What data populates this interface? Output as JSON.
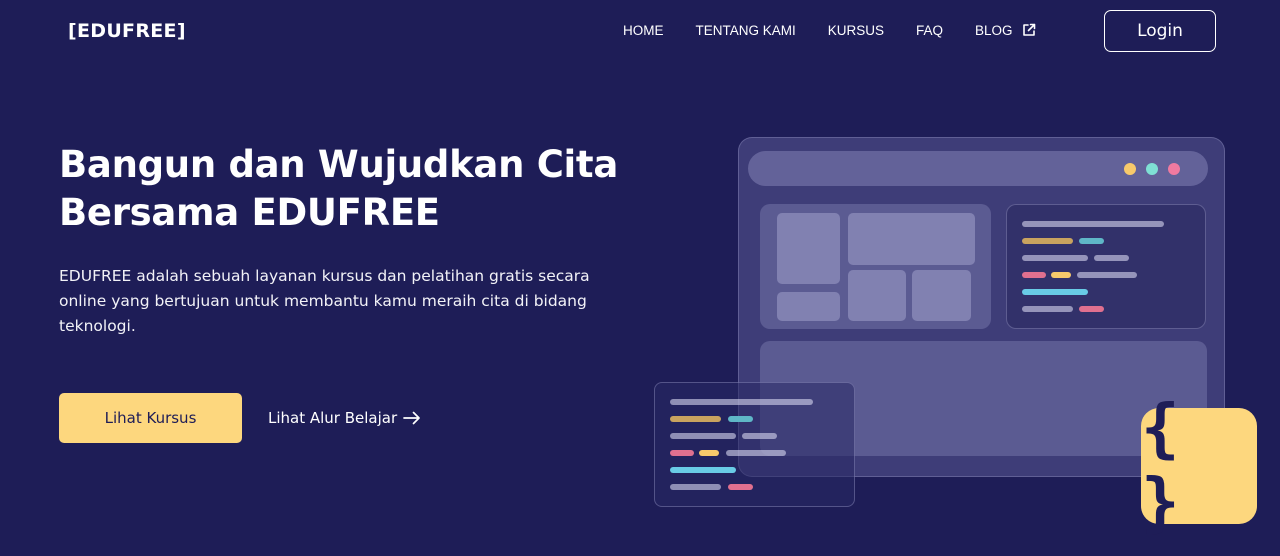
{
  "nav": {
    "brand": "[EDUFREE]",
    "links": [
      {
        "label": "HOME"
      },
      {
        "label": "TENTANG KAMI"
      },
      {
        "label": "KURSUS"
      },
      {
        "label": "FAQ"
      },
      {
        "label": "BLOG",
        "icon": "external-link-icon"
      }
    ],
    "login_label": "Login"
  },
  "hero": {
    "title": "Bangun dan Wujudkan Cita Bersama EDUFREE",
    "description": "EDUFREE adalah sebuah layanan kursus dan pelatihan gratis secara online yang bertujuan untuk membantu kamu meraih cita di bidang teknologi.",
    "primary_button": "Lihat Kursus",
    "secondary_link": "Lihat Alur Belajar",
    "secondary_icon": "arrow-right-icon"
  },
  "illustration": {
    "badge_icon": "curly-braces-icon",
    "badge_text": "{ }"
  },
  "colors": {
    "background": "#1e1d57",
    "accent": "#fdd77e",
    "dot_yellow": "#f7c96b",
    "dot_teal": "#7fe0d4",
    "dot_pink": "#f07aa0",
    "code_gold": "#c9a35f",
    "code_teal": "#5fb7c7",
    "code_pink": "#e0708f",
    "code_cyan": "#69cbe6"
  }
}
